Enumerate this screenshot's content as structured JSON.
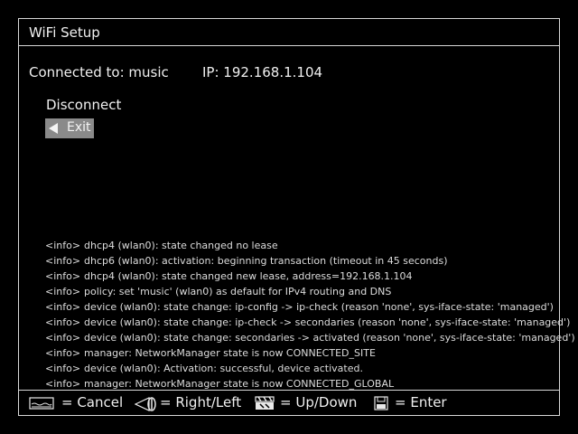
{
  "title": "WiFi Setup",
  "status": {
    "connected": "Connected to: music",
    "ip": "IP: 192.168.1.104"
  },
  "menu": {
    "disconnect": "Disconnect",
    "exit": "Exit"
  },
  "log": [
    {
      "level": "<info>",
      "msg": "dhcp4 (wlan0): state changed no lease"
    },
    {
      "level": "<info>",
      "msg": "dhcp6 (wlan0): activation: beginning transaction (timeout in 45 seconds)"
    },
    {
      "level": "<info>",
      "msg": "dhcp4 (wlan0): state changed new lease, address=192.168.1.104"
    },
    {
      "level": "<info>",
      "msg": "policy: set 'music' (wlan0) as default for IPv4 routing and DNS"
    },
    {
      "level": "<info>",
      "msg": "device (wlan0): state change: ip-config -> ip-check (reason 'none', sys-iface-state: 'managed')"
    },
    {
      "level": "<info>",
      "msg": "device (wlan0): state change: ip-check -> secondaries (reason 'none', sys-iface-state: 'managed')"
    },
    {
      "level": "<info>",
      "msg": "device (wlan0): state change: secondaries -> activated (reason 'none', sys-iface-state: 'managed')"
    },
    {
      "level": "<info>",
      "msg": "manager: NetworkManager state is now CONNECTED_SITE"
    },
    {
      "level": "<info>",
      "msg": "device (wlan0): Activation: successful, device activated."
    },
    {
      "level": "<info>",
      "msg": "manager: NetworkManager state is now CONNECTED_GLOBAL"
    }
  ],
  "footer": {
    "cancel": "= Cancel",
    "right_left": "= Right/Left",
    "up_down": "= Up/Down",
    "enter": "= Enter",
    "cancel_icon": "pedal-icon",
    "right_left_icon": "wheel-icon",
    "up_down_icon": "clapper-icon",
    "enter_icon": "floppy-icon"
  }
}
